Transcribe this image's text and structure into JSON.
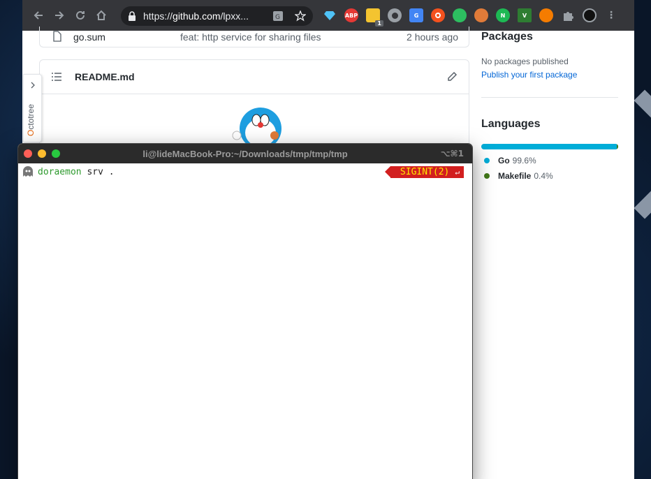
{
  "browser": {
    "url_prefix": "https://",
    "url_host": "github.com",
    "url_rest": "/lpxx...",
    "extensions": [
      "sapphire-icon",
      "abp-icon",
      "sticky-note-icon",
      "circle-ext-icon",
      "google-translate-icon",
      "bullseye-icon",
      "evernote-icon",
      "monkey-icon",
      "n-icon",
      "vimium-icon",
      "tiger-icon",
      "puzzle-icon",
      "avatar-icon"
    ],
    "extension_labels": {
      "abp": "ABP",
      "n": "N",
      "v": "V",
      "sticky_badge": "1"
    }
  },
  "repo": {
    "file_row": {
      "name": "go.sum",
      "message": "feat: http service for sharing files",
      "time": "2 hours ago"
    },
    "readme_title": "README.md"
  },
  "octotree": {
    "label_first": "O",
    "label_rest": "ctotree"
  },
  "sidebar": {
    "packages_heading": "Packages",
    "packages_text": "No packages published",
    "packages_link": "Publish your first package",
    "languages_heading": "Languages",
    "languages": [
      {
        "name": "Go",
        "percent": "99.6%",
        "color": "#00add8"
      },
      {
        "name": "Makefile",
        "percent": "0.4%",
        "color": "#427819"
      }
    ]
  },
  "terminal": {
    "title": "li@lideMacBook-Pro:~/Downloads/tmp/tmp/tmp",
    "shortcut": "⌥⌘1",
    "command_name": "doraemon",
    "command_args": " srv .",
    "signal_label": "SIGINT(2)",
    "signal_enter": "↵"
  }
}
